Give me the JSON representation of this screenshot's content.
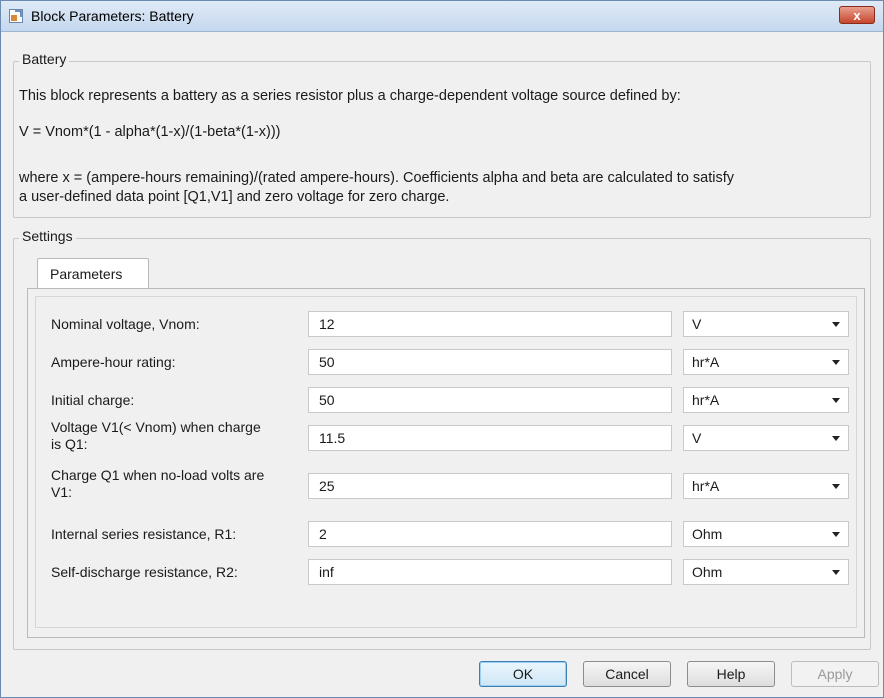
{
  "window": {
    "title": "Block Parameters: Battery",
    "close_label": "x"
  },
  "description_group": {
    "legend": "Battery",
    "line1": "This block represents a battery as a series resistor plus a charge-dependent voltage source defined by:",
    "line2": "V = Vnom*(1 - alpha*(1-x)/(1-beta*(1-x)))",
    "line3": "where x = (ampere-hours remaining)/(rated ampere-hours). Coefficients alpha and beta are calculated to satisfy",
    "line4": "a user-defined data point [Q1,V1] and zero voltage for zero charge."
  },
  "settings_group": {
    "legend": "Settings",
    "tab_label": "Parameters"
  },
  "parameters": [
    {
      "label": "Nominal voltage, Vnom:",
      "value": "12",
      "unit": "V"
    },
    {
      "label": "Ampere-hour rating:",
      "value": "50",
      "unit": "hr*A"
    },
    {
      "label": "Initial charge:",
      "value": "50",
      "unit": "hr*A"
    },
    {
      "label": "Voltage V1(< Vnom) when charge is Q1:",
      "value": "11.5",
      "unit": "V"
    },
    {
      "label": "Charge Q1 when no-load volts are V1:",
      "value": "25",
      "unit": "hr*A"
    },
    {
      "label": "Internal series resistance, R1:",
      "value": "2",
      "unit": "Ohm"
    },
    {
      "label": "Self-discharge resistance, R2:",
      "value": "inf",
      "unit": "Ohm"
    }
  ],
  "buttons": {
    "ok": "OK",
    "cancel": "Cancel",
    "help": "Help",
    "apply": "Apply"
  },
  "colors": {
    "titlebar": "#c5d8ee",
    "close_button": "#c6452c",
    "ok_border": "#3c7fb1"
  },
  "icons": {
    "app": "simulink-block-icon",
    "close": "close-icon",
    "dropdown": "chevron-down-icon"
  }
}
